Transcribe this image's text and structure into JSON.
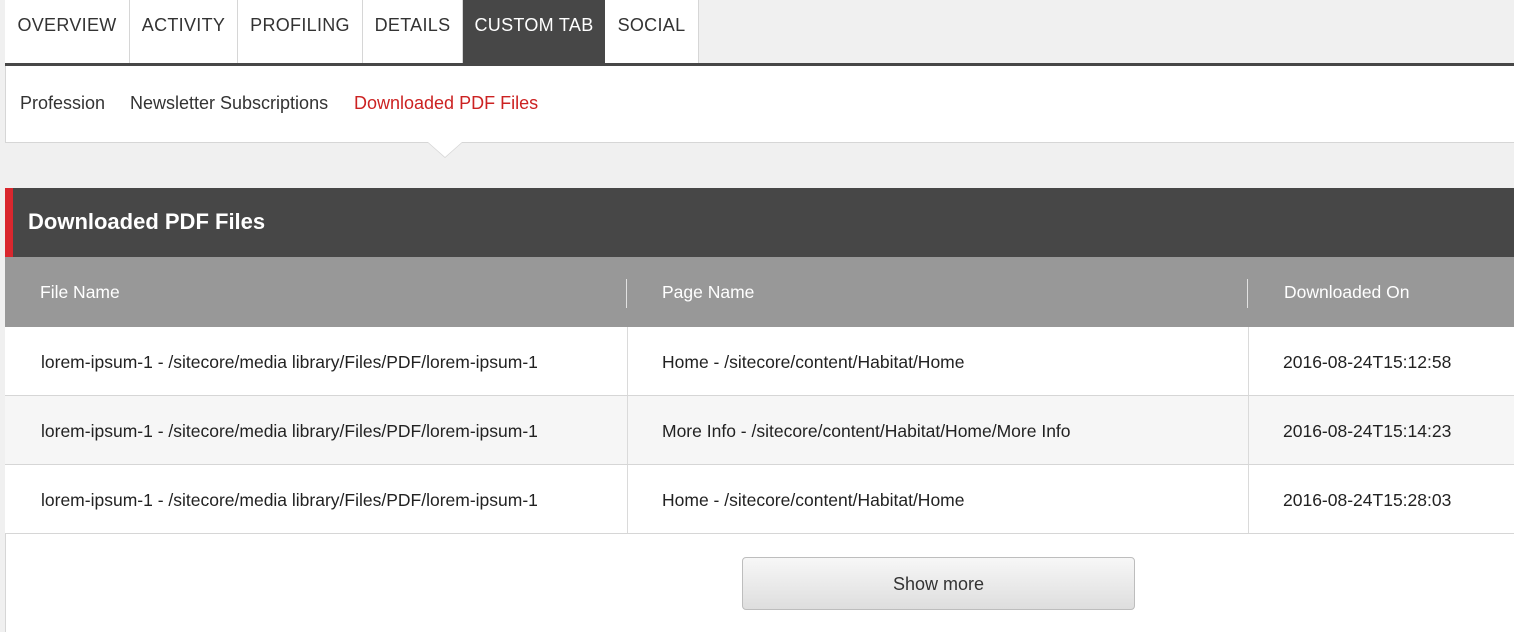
{
  "top_tabs": [
    {
      "label": "OVERVIEW",
      "active": false
    },
    {
      "label": "ACTIVITY",
      "active": false
    },
    {
      "label": "PROFILING",
      "active": false
    },
    {
      "label": "DETAILS",
      "active": false
    },
    {
      "label": "CUSTOM TAB",
      "active": true
    },
    {
      "label": "SOCIAL",
      "active": false
    }
  ],
  "sub_nav": [
    {
      "label": "Profession",
      "active": false
    },
    {
      "label": "Newsletter Subscriptions",
      "active": false
    },
    {
      "label": "Downloaded PDF Files",
      "active": true
    }
  ],
  "panel": {
    "title": "Downloaded PDF Files",
    "accent_color": "#d9272e",
    "columns": [
      "File Name",
      "Page Name",
      "Downloaded On"
    ],
    "rows": [
      [
        "lorem-ipsum-1 - /sitecore/media library/Files/PDF/lorem-ipsum-1",
        "Home - /sitecore/content/Habitat/Home",
        "2016-08-24T15:12:58"
      ],
      [
        "lorem-ipsum-1 - /sitecore/media library/Files/PDF/lorem-ipsum-1",
        "More Info - /sitecore/content/Habitat/Home/More Info",
        "2016-08-24T15:14:23"
      ],
      [
        "lorem-ipsum-1 - /sitecore/media library/Files/PDF/lorem-ipsum-1",
        "Home - /sitecore/content/Habitat/Home",
        "2016-08-24T15:28:03"
      ]
    ],
    "show_more_label": "Show more"
  }
}
